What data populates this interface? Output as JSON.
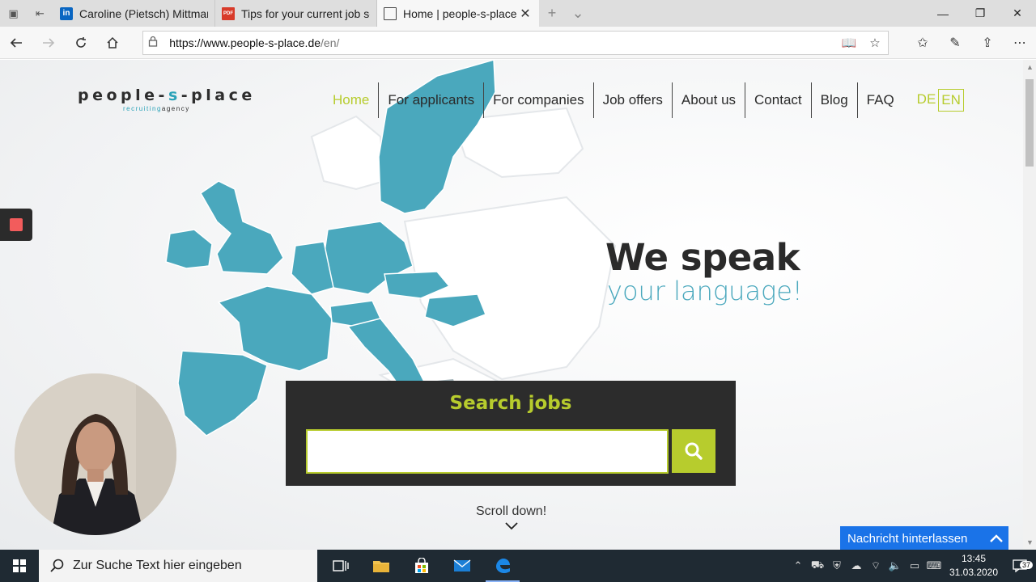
{
  "browser": {
    "tabs": [
      {
        "title": "Caroline (Pietsch) Mittmann",
        "icon": "linkedin-icon",
        "active": false
      },
      {
        "title": "Tips for your current job sea",
        "icon": "pdf-icon",
        "active": false
      },
      {
        "title": "Home | people-s-place",
        "icon": "page-icon",
        "active": true
      }
    ],
    "url_host": "https://www.people-s-place.de",
    "url_path": "/en/"
  },
  "site": {
    "logo_main_a": "people-",
    "logo_main_s": "s",
    "logo_main_b": "-place",
    "logo_sub_a": "recruiting",
    "logo_sub_b": "agency",
    "nav": [
      "Home",
      "For applicants",
      "For companies",
      "Job offers",
      "About us",
      "Contact",
      "Blog",
      "FAQ"
    ],
    "active_nav": "Home",
    "lang_de": "DE",
    "lang_en": "EN",
    "slogan_big": "We speak",
    "slogan_small": "your language!",
    "search_title": "Search jobs",
    "search_value": "",
    "scroll_hint": "Scroll down!",
    "chat_label": "Nachricht hinterlassen",
    "colors": {
      "accent": "#b7cc2d",
      "map": "#4aa8bd",
      "dark": "#2c2c2c",
      "chat": "#1a73e8"
    }
  },
  "taskbar": {
    "search_placeholder": "Zur Suche Text hier eingeben",
    "time": "13:45",
    "date": "31.03.2020",
    "notifications": "37"
  }
}
